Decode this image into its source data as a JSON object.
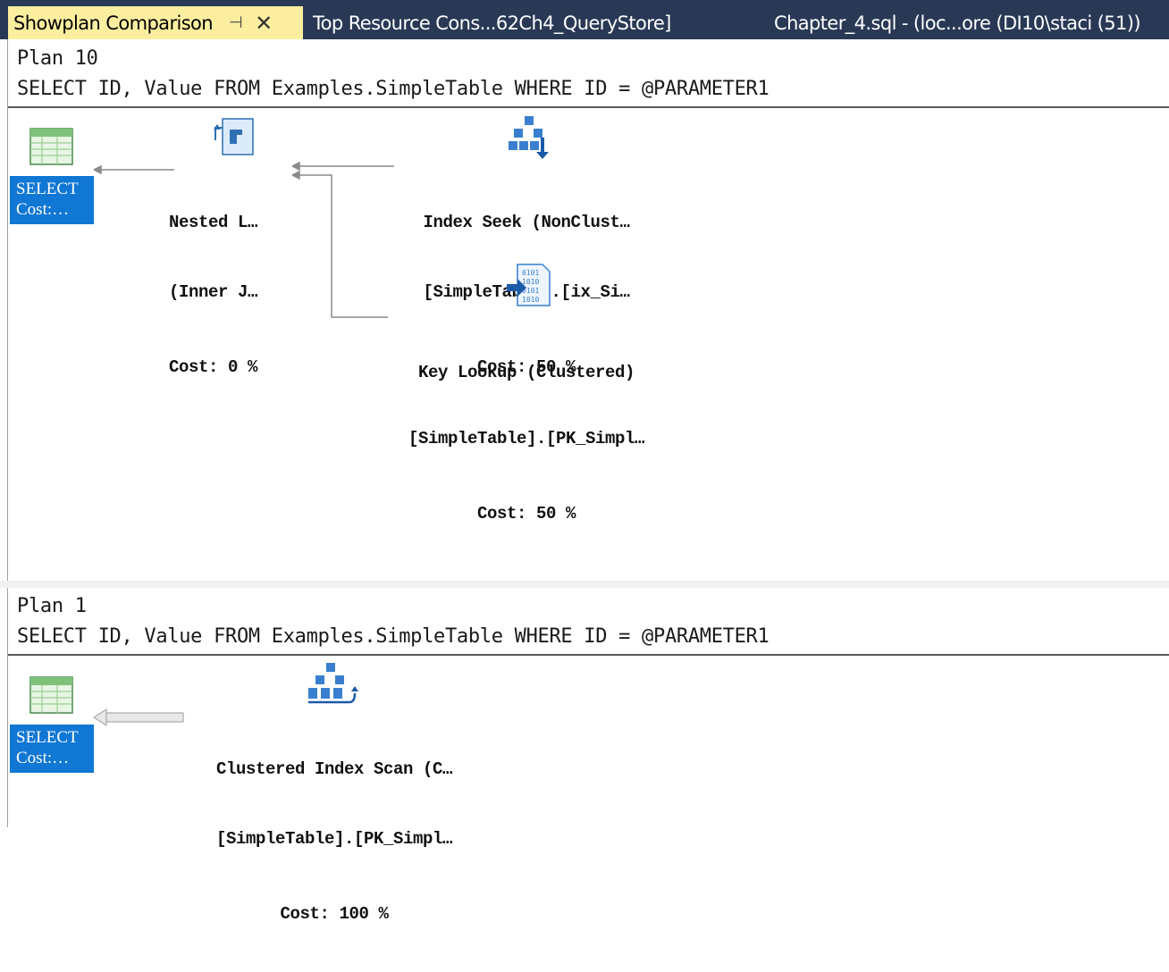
{
  "tabs": [
    {
      "label": "Showplan Comparison",
      "active": true
    },
    {
      "label": "Top Resource Cons...62Ch4_QueryStore]",
      "active": false
    },
    {
      "label": "Chapter_4.sql - (loc...ore (DI10\\staci (51))",
      "active": false
    }
  ],
  "tab_icons": {
    "pin": "pin-icon",
    "close": "close-icon"
  },
  "tab_glyphs": {
    "pin": "⊣",
    "close": "✕"
  },
  "colors": {
    "tab_active_bg": "#fcee9f",
    "tabstrip_bg": "#293955",
    "select_bg": "#1177d4"
  },
  "plan_top": {
    "name": "Plan 10",
    "query": "SELECT ID, Value FROM Examples.SimpleTable WHERE ID = @PARAMETER1",
    "select": {
      "line1": "SELECT",
      "line2": "Cost:…"
    },
    "nested": {
      "line1": "Nested L…",
      "line2": "(Inner J…",
      "cost": "Cost: 0 %"
    },
    "seek": {
      "line1": "Index Seek (NonClust…",
      "line2": "[SimpleTable].[ix_Si…",
      "cost": "Cost: 50 %"
    },
    "lookup": {
      "line1": "Key Lookup (Clustered)",
      "line2": "[SimpleTable].[PK_Simpl…",
      "cost": "Cost: 50 %"
    }
  },
  "plan_bottom": {
    "name": "Plan 1",
    "query": "SELECT ID, Value FROM Examples.SimpleTable WHERE ID = @PARAMETER1",
    "select": {
      "line1": "SELECT",
      "line2": "Cost:…"
    },
    "scan": {
      "line1": "Clustered Index Scan (C…",
      "line2": "[SimpleTable].[PK_Simpl…",
      "cost": "Cost: 100 %"
    }
  }
}
